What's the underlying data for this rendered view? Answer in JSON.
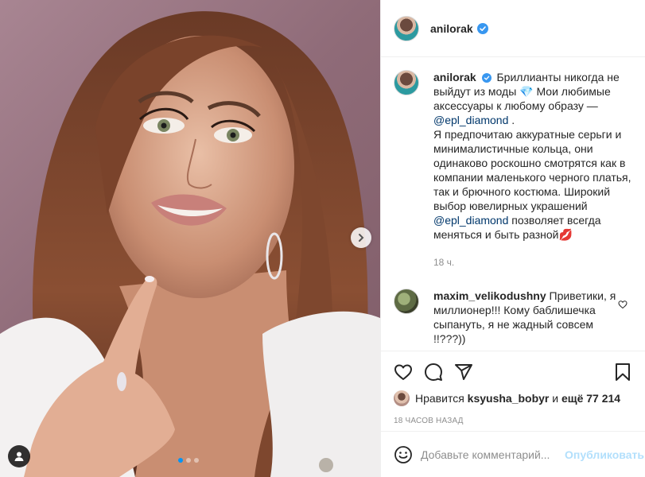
{
  "post": {
    "author": "anilorak",
    "verified": true,
    "carousel": {
      "slides": 3,
      "active_index": 0
    }
  },
  "caption": {
    "username": "anilorak",
    "text_1": "Бриллианты никогда не выйдут из моды 💎 Мои любимые аксессуары к любому образу —",
    "mention_1": "@epl_diamond",
    "text_2": ".",
    "text_3": "Я предпочитаю аккуратные серьги и минималистичные кольца, они одинаково роскошно смотрятся как в компании маленького черного платья, так и брючного костюма. Широкий выбор ювелирных украшений",
    "mention_2": "@epl_diamond",
    "text_4": "позволяет всегда меняться и быть разной💋",
    "time": "18 ч."
  },
  "comments": [
    {
      "username": "maxim_velikodushny",
      "text": "Приветики, я миллионер!!! Кому баблишечка сыпануть, я не жадный совсем !!???))"
    }
  ],
  "likes": {
    "prefix": "Нравится",
    "user": "ksyusha_bobyr",
    "middle": "и",
    "others": "ещё 77 214"
  },
  "date": "18 ЧАСОВ НАЗАД",
  "add_comment": {
    "placeholder": "Добавьте комментарий...",
    "publish_label": "Опубликовать"
  },
  "icons": {
    "like": "heart-icon",
    "comment": "comment-icon",
    "share": "share-icon",
    "save": "bookmark-icon",
    "emoji": "emoji-icon",
    "next": "chevron-right-icon",
    "tags": "user-tag-icon",
    "verified": "verified-badge-icon"
  },
  "colors": {
    "accent": "#0095f6",
    "publish_disabled": "#b2dffc",
    "mention": "#00376b",
    "muted": "#8e8e8e"
  }
}
